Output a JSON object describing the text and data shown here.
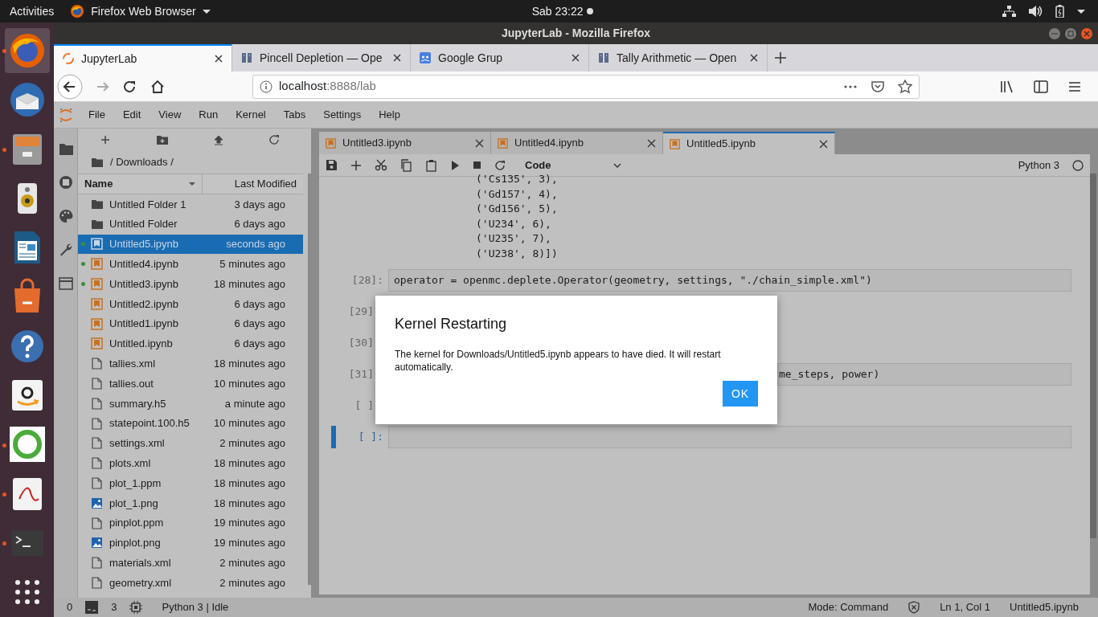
{
  "top_bar": {
    "activities": "Activities",
    "app_menu": "Firefox Web Browser",
    "clock": "Sab 23:22",
    "notification": true
  },
  "dock": [
    {
      "kind": "firefox",
      "running": true,
      "selected": true
    },
    {
      "kind": "mail",
      "running": false,
      "selected": false
    },
    {
      "kind": "files",
      "running": true,
      "selected": false
    },
    {
      "kind": "speaker",
      "running": false,
      "selected": false
    },
    {
      "kind": "writer",
      "running": false,
      "selected": false
    },
    {
      "kind": "bag",
      "running": false,
      "selected": false
    },
    {
      "kind": "help",
      "running": false,
      "selected": false
    },
    {
      "kind": "amazon",
      "running": false,
      "selected": false
    },
    {
      "kind": "ring",
      "running": true,
      "selected": false
    },
    {
      "kind": "pdf",
      "running": true,
      "selected": false
    },
    {
      "kind": "terminal",
      "running": true,
      "selected": false
    },
    {
      "kind": "grid",
      "running": false,
      "selected": false
    }
  ],
  "window": {
    "title": "JupyterLab - Mozilla Firefox"
  },
  "browser_tabs": [
    {
      "label": "JupyterLab",
      "kind": "jupyter",
      "selected": true
    },
    {
      "label": "Pincell Depletion — Ope",
      "kind": "book",
      "selected": false
    },
    {
      "label": "Google Grup",
      "kind": "groups",
      "selected": false
    },
    {
      "label": "Tally Arithmetic — Open",
      "kind": "book",
      "selected": false
    }
  ],
  "address_bar": {
    "host": "localhost",
    "rest": ":8888/lab"
  },
  "menu": [
    "File",
    "Edit",
    "View",
    "Run",
    "Kernel",
    "Tabs",
    "Settings",
    "Help"
  ],
  "file_browser": {
    "breadcrumb": "/ Downloads /",
    "columns": [
      "Name",
      "Last Modified"
    ],
    "items": [
      {
        "name": "Untitled Folder 1",
        "modified": "3 days ago",
        "kind": "folder",
        "running": false,
        "selected": false
      },
      {
        "name": "Untitled Folder",
        "modified": "6 days ago",
        "kind": "folder",
        "running": false,
        "selected": false
      },
      {
        "name": "Untitled5.ipynb",
        "modified": "seconds ago",
        "kind": "notebook",
        "running": true,
        "selected": true
      },
      {
        "name": "Untitled4.ipynb",
        "modified": "5 minutes ago",
        "kind": "notebook",
        "running": true,
        "selected": false
      },
      {
        "name": "Untitled3.ipynb",
        "modified": "18 minutes ago",
        "kind": "notebook",
        "running": true,
        "selected": false
      },
      {
        "name": "Untitled2.ipynb",
        "modified": "6 days ago",
        "kind": "notebook",
        "running": false,
        "selected": false
      },
      {
        "name": "Untitled1.ipynb",
        "modified": "6 days ago",
        "kind": "notebook",
        "running": false,
        "selected": false
      },
      {
        "name": "Untitled.ipynb",
        "modified": "6 days ago",
        "kind": "notebook",
        "running": false,
        "selected": false
      },
      {
        "name": "tallies.xml",
        "modified": "18 minutes ago",
        "kind": "file",
        "running": false,
        "selected": false
      },
      {
        "name": "tallies.out",
        "modified": "10 minutes ago",
        "kind": "file",
        "running": false,
        "selected": false
      },
      {
        "name": "summary.h5",
        "modified": "a minute ago",
        "kind": "file",
        "running": false,
        "selected": false
      },
      {
        "name": "statepoint.100.h5",
        "modified": "10 minutes ago",
        "kind": "file",
        "running": false,
        "selected": false
      },
      {
        "name": "settings.xml",
        "modified": "2 minutes ago",
        "kind": "file",
        "running": false,
        "selected": false
      },
      {
        "name": "plots.xml",
        "modified": "18 minutes ago",
        "kind": "file",
        "running": false,
        "selected": false
      },
      {
        "name": "plot_1.ppm",
        "modified": "18 minutes ago",
        "kind": "file",
        "running": false,
        "selected": false
      },
      {
        "name": "plot_1.png",
        "modified": "18 minutes ago",
        "kind": "image",
        "running": false,
        "selected": false
      },
      {
        "name": "pinplot.ppm",
        "modified": "19 minutes ago",
        "kind": "file",
        "running": false,
        "selected": false
      },
      {
        "name": "pinplot.png",
        "modified": "19 minutes ago",
        "kind": "image",
        "running": false,
        "selected": false
      },
      {
        "name": "materials.xml",
        "modified": "2 minutes ago",
        "kind": "file",
        "running": false,
        "selected": false
      },
      {
        "name": "geometry.xml",
        "modified": "2 minutes ago",
        "kind": "file",
        "running": false,
        "selected": false
      }
    ]
  },
  "notebook_tabs": [
    {
      "label": "Untitled3.ipynb",
      "selected": false
    },
    {
      "label": "Untitled4.ipynb",
      "selected": false
    },
    {
      "label": "Untitled5.ipynb",
      "selected": true
    }
  ],
  "toolbar": {
    "cell_type": "Code",
    "kernel": "Python 3"
  },
  "output_lines": [
    "('Cs135', 3),",
    "('Gd157', 4),",
    "('Gd156', 5),",
    "('U234', 6),",
    "('U235', 7),",
    "('U238', 8)])"
  ],
  "cells": [
    {
      "prompt": "[28]:",
      "code": "operator = openmc.deplete.Operator(geometry, settings, \"./chain_simple.xml\")",
      "kind": "full",
      "active": false
    },
    {
      "prompt": "[29]",
      "kind": "hidden",
      "active": false
    },
    {
      "prompt": "[30]",
      "kind": "hidden",
      "active": false
    },
    {
      "prompt": "[31]",
      "code": "me_steps, power)",
      "kind": "tail",
      "active": false
    },
    {
      "prompt": "[ ]",
      "kind": "hidden",
      "active": false
    },
    {
      "prompt": "[ ]:",
      "kind": "full",
      "active": true
    }
  ],
  "dialog": {
    "title": "Kernel Restarting",
    "message": "The kernel for Downloads/Untitled5.ipynb appears to have died. It will restart automatically.",
    "button": "OK"
  },
  "status_bar": {
    "terminals": "0",
    "kernels": "3",
    "kernel_status": "Python 3 | Idle",
    "mode": "Mode: Command",
    "position": "Ln 1, Col 1",
    "file": "Untitled5.ipynb"
  }
}
